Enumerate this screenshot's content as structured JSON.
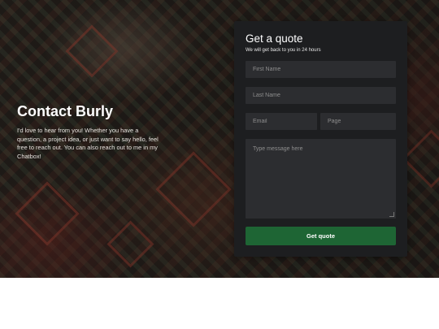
{
  "intro": {
    "title": "Contact Burly",
    "text": "I'd love to hear from you! Whether you have a question, a project idea, or just want to say hello, feel free to reach out. You can also reach out to me in my Chatbox!"
  },
  "form": {
    "title": "Get a quote",
    "subtitle": "We will get back to you in 24 hours",
    "first_name_placeholder": "First Name",
    "last_name_placeholder": "Last Name",
    "email_placeholder": "Email",
    "page_placeholder": "Page",
    "message_placeholder": "Type message here",
    "submit_label": "Get quote"
  },
  "colors": {
    "card_background": "#1d1e20",
    "field_background": "#2c2d30",
    "submit_background": "#1e6534",
    "page_background": "#ffffff"
  }
}
